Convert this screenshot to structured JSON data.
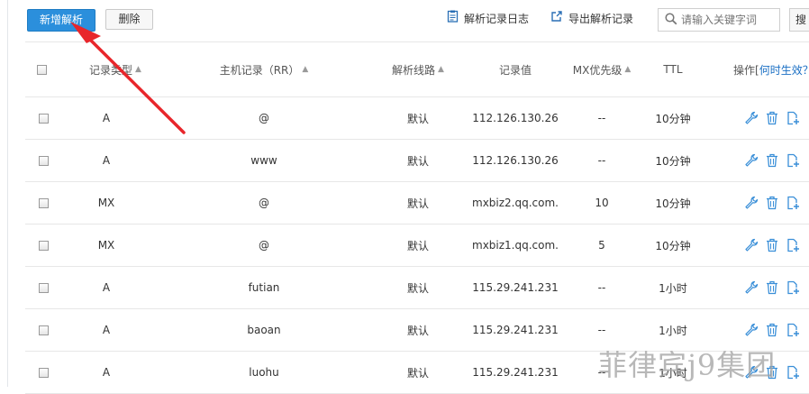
{
  "toolbar": {
    "add_label": "新增解析",
    "delete_label": "删除",
    "log_label": "解析记录日志",
    "export_label": "导出解析记录",
    "search_placeholder": "请输入关键字词",
    "search_button_label": "搜"
  },
  "table": {
    "columns": [
      "记录类型",
      "主机记录（RR）",
      "解析线路",
      "记录值",
      "MX优先级",
      "TTL"
    ],
    "ops_header_prefix": "操作[",
    "ops_header_link": "何时生效？",
    "rows": [
      {
        "type": "A",
        "host": "@",
        "line": "默认",
        "value": "112.126.130.26",
        "mx": "--",
        "ttl": "10分钟"
      },
      {
        "type": "A",
        "host": "www",
        "line": "默认",
        "value": "112.126.130.26",
        "mx": "--",
        "ttl": "10分钟"
      },
      {
        "type": "MX",
        "host": "@",
        "line": "默认",
        "value": "mxbiz2.qq.com.",
        "mx": "10",
        "ttl": "10分钟"
      },
      {
        "type": "MX",
        "host": "@",
        "line": "默认",
        "value": "mxbiz1.qq.com.",
        "mx": "5",
        "ttl": "10分钟"
      },
      {
        "type": "A",
        "host": "futian",
        "line": "默认",
        "value": "115.29.241.231",
        "mx": "--",
        "ttl": "1小时"
      },
      {
        "type": "A",
        "host": "baoan",
        "line": "默认",
        "value": "115.29.241.231",
        "mx": "--",
        "ttl": "1小时"
      },
      {
        "type": "A",
        "host": "luohu",
        "line": "默认",
        "value": "115.29.241.231",
        "mx": "--",
        "ttl": "1小时"
      }
    ]
  },
  "icons": {
    "edit": "wrench-icon",
    "delete": "trash-icon",
    "copy": "add-copy-icon"
  },
  "colors": {
    "primary": "#2b8fdc",
    "icon": "#3a8fd8",
    "arrow": "#e8262b"
  },
  "watermark": "菲律宾j9集团"
}
